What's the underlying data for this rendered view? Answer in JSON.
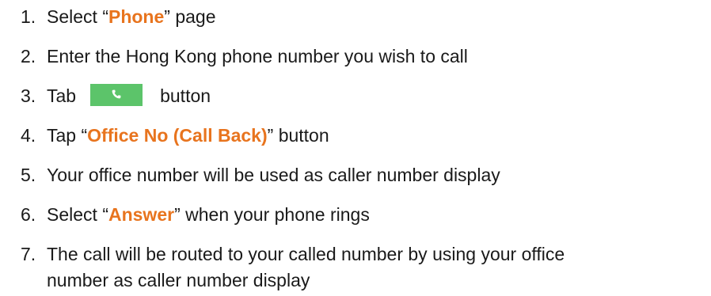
{
  "steps": [
    {
      "num": "1.",
      "pre": "Select “",
      "hl": "Phone",
      "post": "” page"
    },
    {
      "num": "2.",
      "text": "Enter the Hong Kong phone number you wish to call"
    },
    {
      "num": "3.",
      "pre": "Tab",
      "post": "button",
      "icon": "phone-handset-icon",
      "button_color": "#5cc46a"
    },
    {
      "num": "4.",
      "pre": "Tap “",
      "hl": "Office No (Call Back)",
      "post": "” button"
    },
    {
      "num": "5.",
      "text": "Your office number will be used as caller number display"
    },
    {
      "num": "6.",
      "pre": "Select “",
      "hl": "Answer",
      "post": "” when your phone rings"
    },
    {
      "num": "7.",
      "text": "The call will be routed to your called number by using your office",
      "cont": "number as caller number display"
    }
  ],
  "colors": {
    "highlight": "#e8741e",
    "text": "#1a1a1a"
  }
}
